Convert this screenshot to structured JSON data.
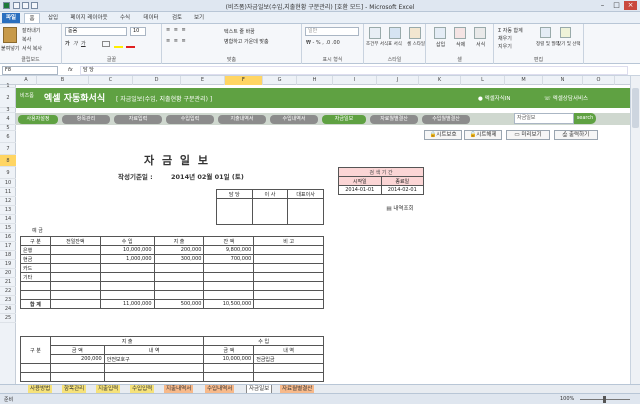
{
  "window": {
    "title": "(비즈폼)자금일보(수입,지출현황 구분관리) [호환 모드] - Microsoft Excel"
  },
  "ribbon_tabs": [
    "파일",
    "홈",
    "삽입",
    "페이지 레이아웃",
    "수식",
    "데이터",
    "검토",
    "보기"
  ],
  "ribbon": {
    "clipboard": {
      "paste": "붙여넣기",
      "cut": "잘라내기",
      "copy": "복사",
      "format_painter": "서식 복사",
      "label": "클립보드"
    },
    "font": {
      "name": "돋움",
      "size": "10",
      "label": "글꼴"
    },
    "align": {
      "wrap": "텍스트 줄 바꿈",
      "merge": "병합하고 가운데 맞춤",
      "label": "맞춤"
    },
    "number": {
      "format": "일반",
      "label": "표시 형식"
    },
    "styles": {
      "cond": "조건부 서식",
      "table": "표 서식",
      "cell": "셀 스타일",
      "label": "스타일"
    },
    "cells": {
      "insert": "삽입",
      "delete": "삭제",
      "format": "서식",
      "label": "셀"
    },
    "edit": {
      "autosum": "자동 합계",
      "fill": "채우기",
      "clear": "지우기",
      "sort": "정렬 및 필터",
      "find": "찾기 및 선택",
      "label": "편집"
    }
  },
  "formula_bar": {
    "cell": "F8",
    "fx": "fx",
    "value": "담 당"
  },
  "columns": [
    "A",
    "B",
    "C",
    "D",
    "E",
    "F",
    "G",
    "H",
    "I",
    "J",
    "K",
    "L",
    "M",
    "N",
    "O"
  ],
  "rows": [
    "1",
    "2",
    "3",
    "4",
    "5",
    "6",
    "7",
    "8",
    "9",
    "10",
    "11",
    "12",
    "13",
    "14",
    "15",
    "16",
    "17",
    "18",
    "19",
    "20",
    "21",
    "22",
    "23",
    "24",
    "25"
  ],
  "banner": {
    "brand": "비즈폼",
    "title": "엑셀 자동화서식",
    "subtitle": "[ 자금일보(수입, 지출현황 구분관리) ]",
    "link1": "엑셀자식IN",
    "link2": "엑셀상담서비스"
  },
  "nav": [
    "사용자설정",
    "항목관리",
    "자료입력",
    "수입입력",
    "지출내역서",
    "수입내역서",
    "자금일보",
    "자료월별결산",
    "수입월별결산"
  ],
  "search": {
    "placeholder": "자금일보",
    "button": "search"
  },
  "buttons": {
    "protect": "시트보호",
    "unprotect": "시트해제",
    "preview": "미리보기",
    "print": "출력하기",
    "lookup": "내역조회"
  },
  "report": {
    "title": "자 금 일 보",
    "date_label": "작성기준일 :",
    "date_value": "2014년 02월 01일 (토)",
    "approval": [
      "담 당",
      "이 사",
      "대표이사"
    ],
    "period": {
      "title": "검 색 기 간",
      "start_label": "시작일",
      "end_label": "종료일",
      "start": "2014-01-01",
      "end": "2014-02-01"
    }
  },
  "deposit": {
    "section": "예 금",
    "headers": [
      "구 분",
      "전일잔액",
      "수 입",
      "지 출",
      "잔 액",
      "비 고"
    ],
    "rows": [
      [
        "은행",
        "",
        "10,000,000",
        "200,000",
        "9,800,000",
        ""
      ],
      [
        "현금",
        "",
        "1,000,000",
        "300,000",
        "700,000",
        ""
      ],
      [
        "카드",
        "",
        "",
        "",
        "",
        ""
      ],
      [
        "기타",
        "",
        "",
        "",
        "",
        ""
      ],
      [
        "",
        "",
        "",
        "",
        "",
        ""
      ],
      [
        "",
        "",
        "",
        "",
        "",
        ""
      ]
    ],
    "total": [
      "합 계",
      "",
      "11,000,000",
      "500,000",
      "10,500,000",
      ""
    ]
  },
  "detail": {
    "col0": "구 분",
    "expense": "지 출",
    "income": "수 입",
    "amount": "금 액",
    "desc": "내 역",
    "rows": [
      [
        "200,000",
        "안전보호구",
        "10,000,000",
        "전금입금"
      ]
    ]
  },
  "sheet_tabs": [
    "사용방법",
    "항목관리",
    "지출입력",
    "수입입력",
    "지출내역서",
    "수입내역서",
    "자금일보",
    "자료월별결산"
  ],
  "status": {
    "ready": "준비",
    "zoom": "100%"
  },
  "colors": {
    "accent": "#5fa142",
    "excel": "#2a6fbf",
    "highlight": "#ffd563",
    "period_bg": "#fbd5d5"
  }
}
